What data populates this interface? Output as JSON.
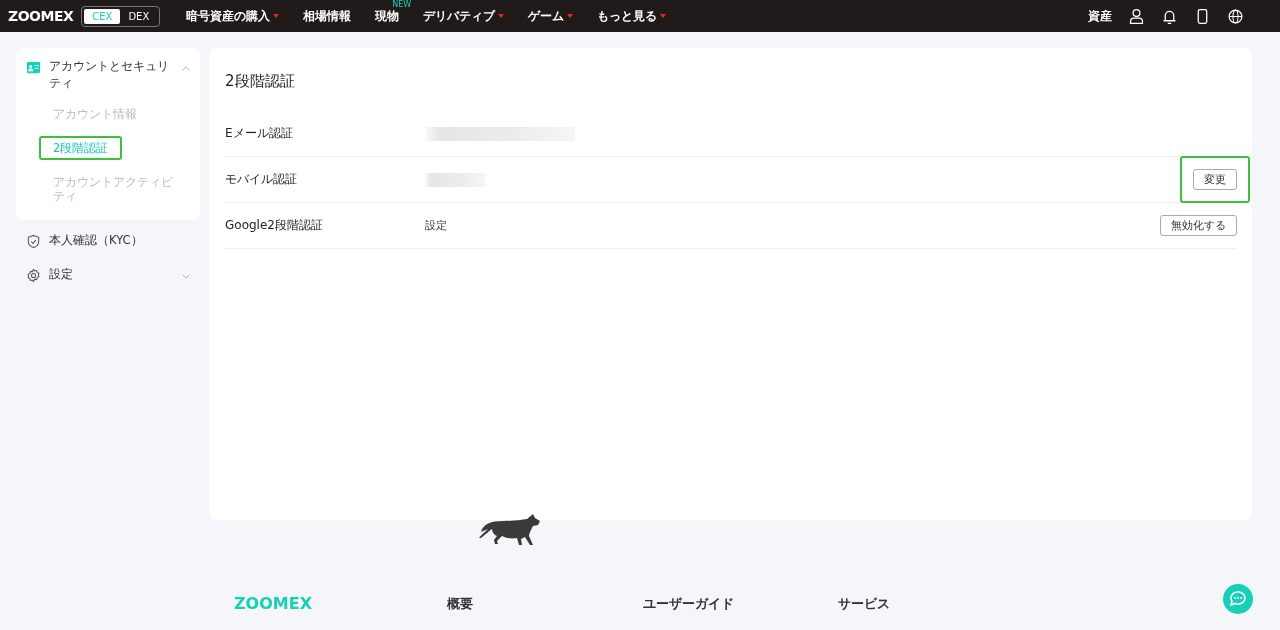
{
  "header": {
    "logo": "ZOOMEX",
    "mode_toggle": [
      {
        "label": "CEX",
        "selected": true
      },
      {
        "label": "DEX",
        "selected": false
      }
    ],
    "nav": [
      {
        "label": "暗号資産の購入",
        "dropdown": true
      },
      {
        "label": "相場情報",
        "dropdown": false
      },
      {
        "label": "現物",
        "dropdown": false,
        "badge": "NEW"
      },
      {
        "label": "デリバティブ",
        "dropdown": true
      },
      {
        "label": "ゲーム",
        "dropdown": true
      },
      {
        "label": "もっと見る",
        "dropdown": true
      }
    ],
    "assets_link": "資産"
  },
  "sidebar": {
    "sections": [
      {
        "label": "アカウントとセキュリティ",
        "expanded": true,
        "children": [
          {
            "label": "アカウント情報",
            "selected": false,
            "highlighted": false
          },
          {
            "label": "2段階認証",
            "selected": true,
            "highlighted": true
          },
          {
            "label": "アカウントアクティビティ",
            "selected": false,
            "highlighted": false
          }
        ]
      },
      {
        "label": "本人確認（KYC）"
      },
      {
        "label": "設定",
        "expanded": false
      }
    ]
  },
  "main": {
    "title": "2段階認証",
    "rows": [
      {
        "label": "Eメール認証",
        "redacted": true
      },
      {
        "label": "モバイル認証",
        "redacted": true,
        "action": {
          "label": "変更",
          "highlighted": true
        }
      },
      {
        "label": "Google2段階認証",
        "value": "設定",
        "action": {
          "label": "無効化する",
          "highlighted": false
        }
      }
    ]
  },
  "footer": {
    "logo": "ZOOMEX",
    "columns": [
      "概要",
      "ユーザーガイド",
      "サービス"
    ]
  }
}
